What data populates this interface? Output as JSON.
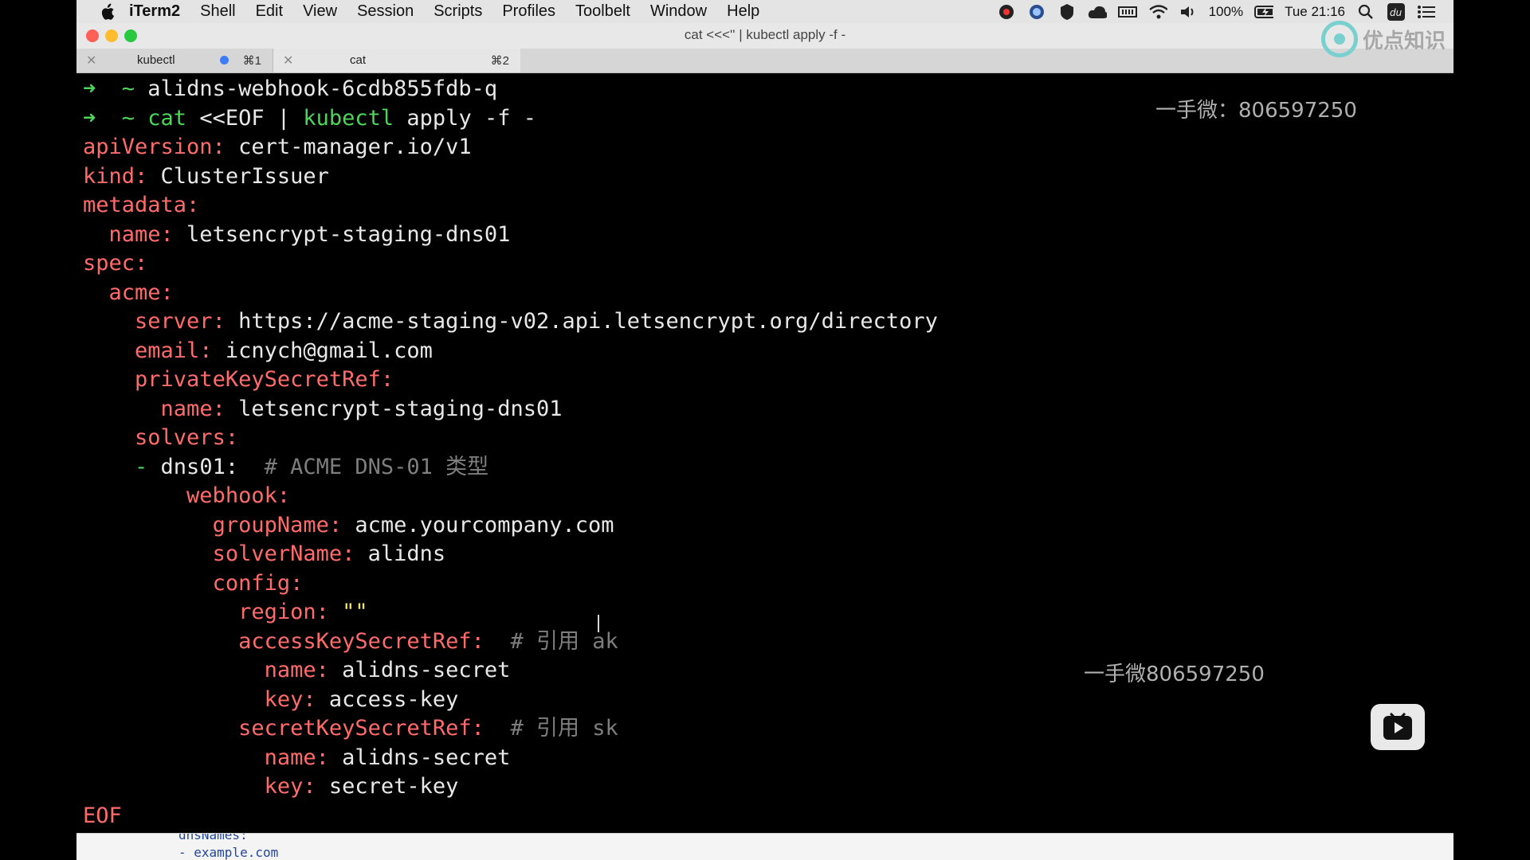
{
  "menubar": {
    "app": "iTerm2",
    "items": [
      "Shell",
      "Edit",
      "View",
      "Session",
      "Scripts",
      "Profiles",
      "Toolbelt",
      "Window",
      "Help"
    ],
    "battery": "100%",
    "clock": "Tue 21:16"
  },
  "window": {
    "title": "cat <<<'' | kubectl apply -f -"
  },
  "tabs": [
    {
      "label": "kubectl",
      "shortcut": "⌘1"
    },
    {
      "label": "cat",
      "shortcut": "⌘2"
    }
  ],
  "terminal": {
    "lines": [
      {
        "segments": [
          {
            "cls": "g",
            "t": "➜  "
          },
          {
            "cls": "g",
            "t": "~ "
          },
          {
            "cls": "w",
            "t": "alidns-webhook-6cdb855fdb-q"
          }
        ]
      },
      {
        "segments": [
          {
            "cls": "g",
            "t": "➜  "
          },
          {
            "cls": "g",
            "t": "~ "
          },
          {
            "cls": "g",
            "t": "cat "
          },
          {
            "cls": "w",
            "t": "<<EOF | "
          },
          {
            "cls": "g",
            "t": "kubectl "
          },
          {
            "cls": "w",
            "t": "apply -f -"
          }
        ]
      },
      {
        "segments": [
          {
            "cls": "k",
            "t": "apiVersion:"
          },
          {
            "cls": "w",
            "t": " cert-manager.io/v1"
          }
        ]
      },
      {
        "segments": [
          {
            "cls": "k",
            "t": "kind:"
          },
          {
            "cls": "w",
            "t": " ClusterIssuer"
          }
        ]
      },
      {
        "segments": [
          {
            "cls": "k",
            "t": "metadata:"
          }
        ]
      },
      {
        "segments": [
          {
            "cls": "w",
            "t": "  "
          },
          {
            "cls": "k",
            "t": "name:"
          },
          {
            "cls": "w",
            "t": " letsencrypt-staging-dns01"
          }
        ]
      },
      {
        "segments": [
          {
            "cls": "k",
            "t": "spec:"
          }
        ]
      },
      {
        "segments": [
          {
            "cls": "w",
            "t": "  "
          },
          {
            "cls": "k",
            "t": "acme:"
          }
        ]
      },
      {
        "segments": [
          {
            "cls": "w",
            "t": "    "
          },
          {
            "cls": "k",
            "t": "server:"
          },
          {
            "cls": "w",
            "t": " https://acme-staging-v02.api.letsencrypt.org/directory"
          }
        ]
      },
      {
        "segments": [
          {
            "cls": "w",
            "t": "    "
          },
          {
            "cls": "k",
            "t": "email:"
          },
          {
            "cls": "w",
            "t": " icnych@gmail.com"
          }
        ]
      },
      {
        "segments": [
          {
            "cls": "w",
            "t": "    "
          },
          {
            "cls": "k",
            "t": "privateKeySecretRef:"
          }
        ]
      },
      {
        "segments": [
          {
            "cls": "w",
            "t": "      "
          },
          {
            "cls": "k",
            "t": "name:"
          },
          {
            "cls": "w",
            "t": " letsencrypt-staging-dns01"
          }
        ]
      },
      {
        "segments": [
          {
            "cls": "w",
            "t": "    "
          },
          {
            "cls": "k",
            "t": "solvers:"
          }
        ]
      },
      {
        "segments": [
          {
            "cls": "w",
            "t": "    "
          },
          {
            "cls": "g",
            "t": "- "
          },
          {
            "cls": "w",
            "t": "dns01:  "
          },
          {
            "cls": "c",
            "t": "# ACME DNS-01 类型"
          }
        ]
      },
      {
        "segments": [
          {
            "cls": "w",
            "t": "        "
          },
          {
            "cls": "k",
            "t": "webhook:"
          }
        ]
      },
      {
        "segments": [
          {
            "cls": "w",
            "t": "          "
          },
          {
            "cls": "k",
            "t": "groupName:"
          },
          {
            "cls": "w",
            "t": " acme.yourcompany.com"
          }
        ]
      },
      {
        "segments": [
          {
            "cls": "w",
            "t": "          "
          },
          {
            "cls": "k",
            "t": "solverName:"
          },
          {
            "cls": "w",
            "t": " alidns"
          }
        ]
      },
      {
        "segments": [
          {
            "cls": "w",
            "t": "          "
          },
          {
            "cls": "k",
            "t": "config:"
          }
        ]
      },
      {
        "segments": [
          {
            "cls": "w",
            "t": "            "
          },
          {
            "cls": "k",
            "t": "region:"
          },
          {
            "cls": "y",
            "t": " \"\""
          }
        ]
      },
      {
        "segments": [
          {
            "cls": "w",
            "t": "            "
          },
          {
            "cls": "k",
            "t": "accessKeySecretRef:"
          },
          {
            "cls": "c",
            "t": "  # 引用 ak"
          }
        ]
      },
      {
        "segments": [
          {
            "cls": "w",
            "t": "              "
          },
          {
            "cls": "k",
            "t": "name:"
          },
          {
            "cls": "w",
            "t": " alidns-secret"
          }
        ]
      },
      {
        "segments": [
          {
            "cls": "w",
            "t": "              "
          },
          {
            "cls": "k",
            "t": "key:"
          },
          {
            "cls": "w",
            "t": " access-key"
          }
        ]
      },
      {
        "segments": [
          {
            "cls": "w",
            "t": "            "
          },
          {
            "cls": "k",
            "t": "secretKeySecretRef:"
          },
          {
            "cls": "c",
            "t": "  # 引用 sk"
          }
        ]
      },
      {
        "segments": [
          {
            "cls": "w",
            "t": "              "
          },
          {
            "cls": "k",
            "t": "name:"
          },
          {
            "cls": "w",
            "t": " alidns-secret"
          }
        ]
      },
      {
        "segments": [
          {
            "cls": "w",
            "t": "              "
          },
          {
            "cls": "k",
            "t": "key:"
          },
          {
            "cls": "w",
            "t": " secret-key"
          }
        ]
      },
      {
        "segments": [
          {
            "cls": "k",
            "t": "EOF"
          }
        ]
      }
    ]
  },
  "overlays": {
    "contact_top": "一手微：806597250",
    "contact_mid": "一手微806597250",
    "brand": "优点知识"
  },
  "bottom_window": {
    "line1": "dnsNames:",
    "line2": "- example.com"
  }
}
